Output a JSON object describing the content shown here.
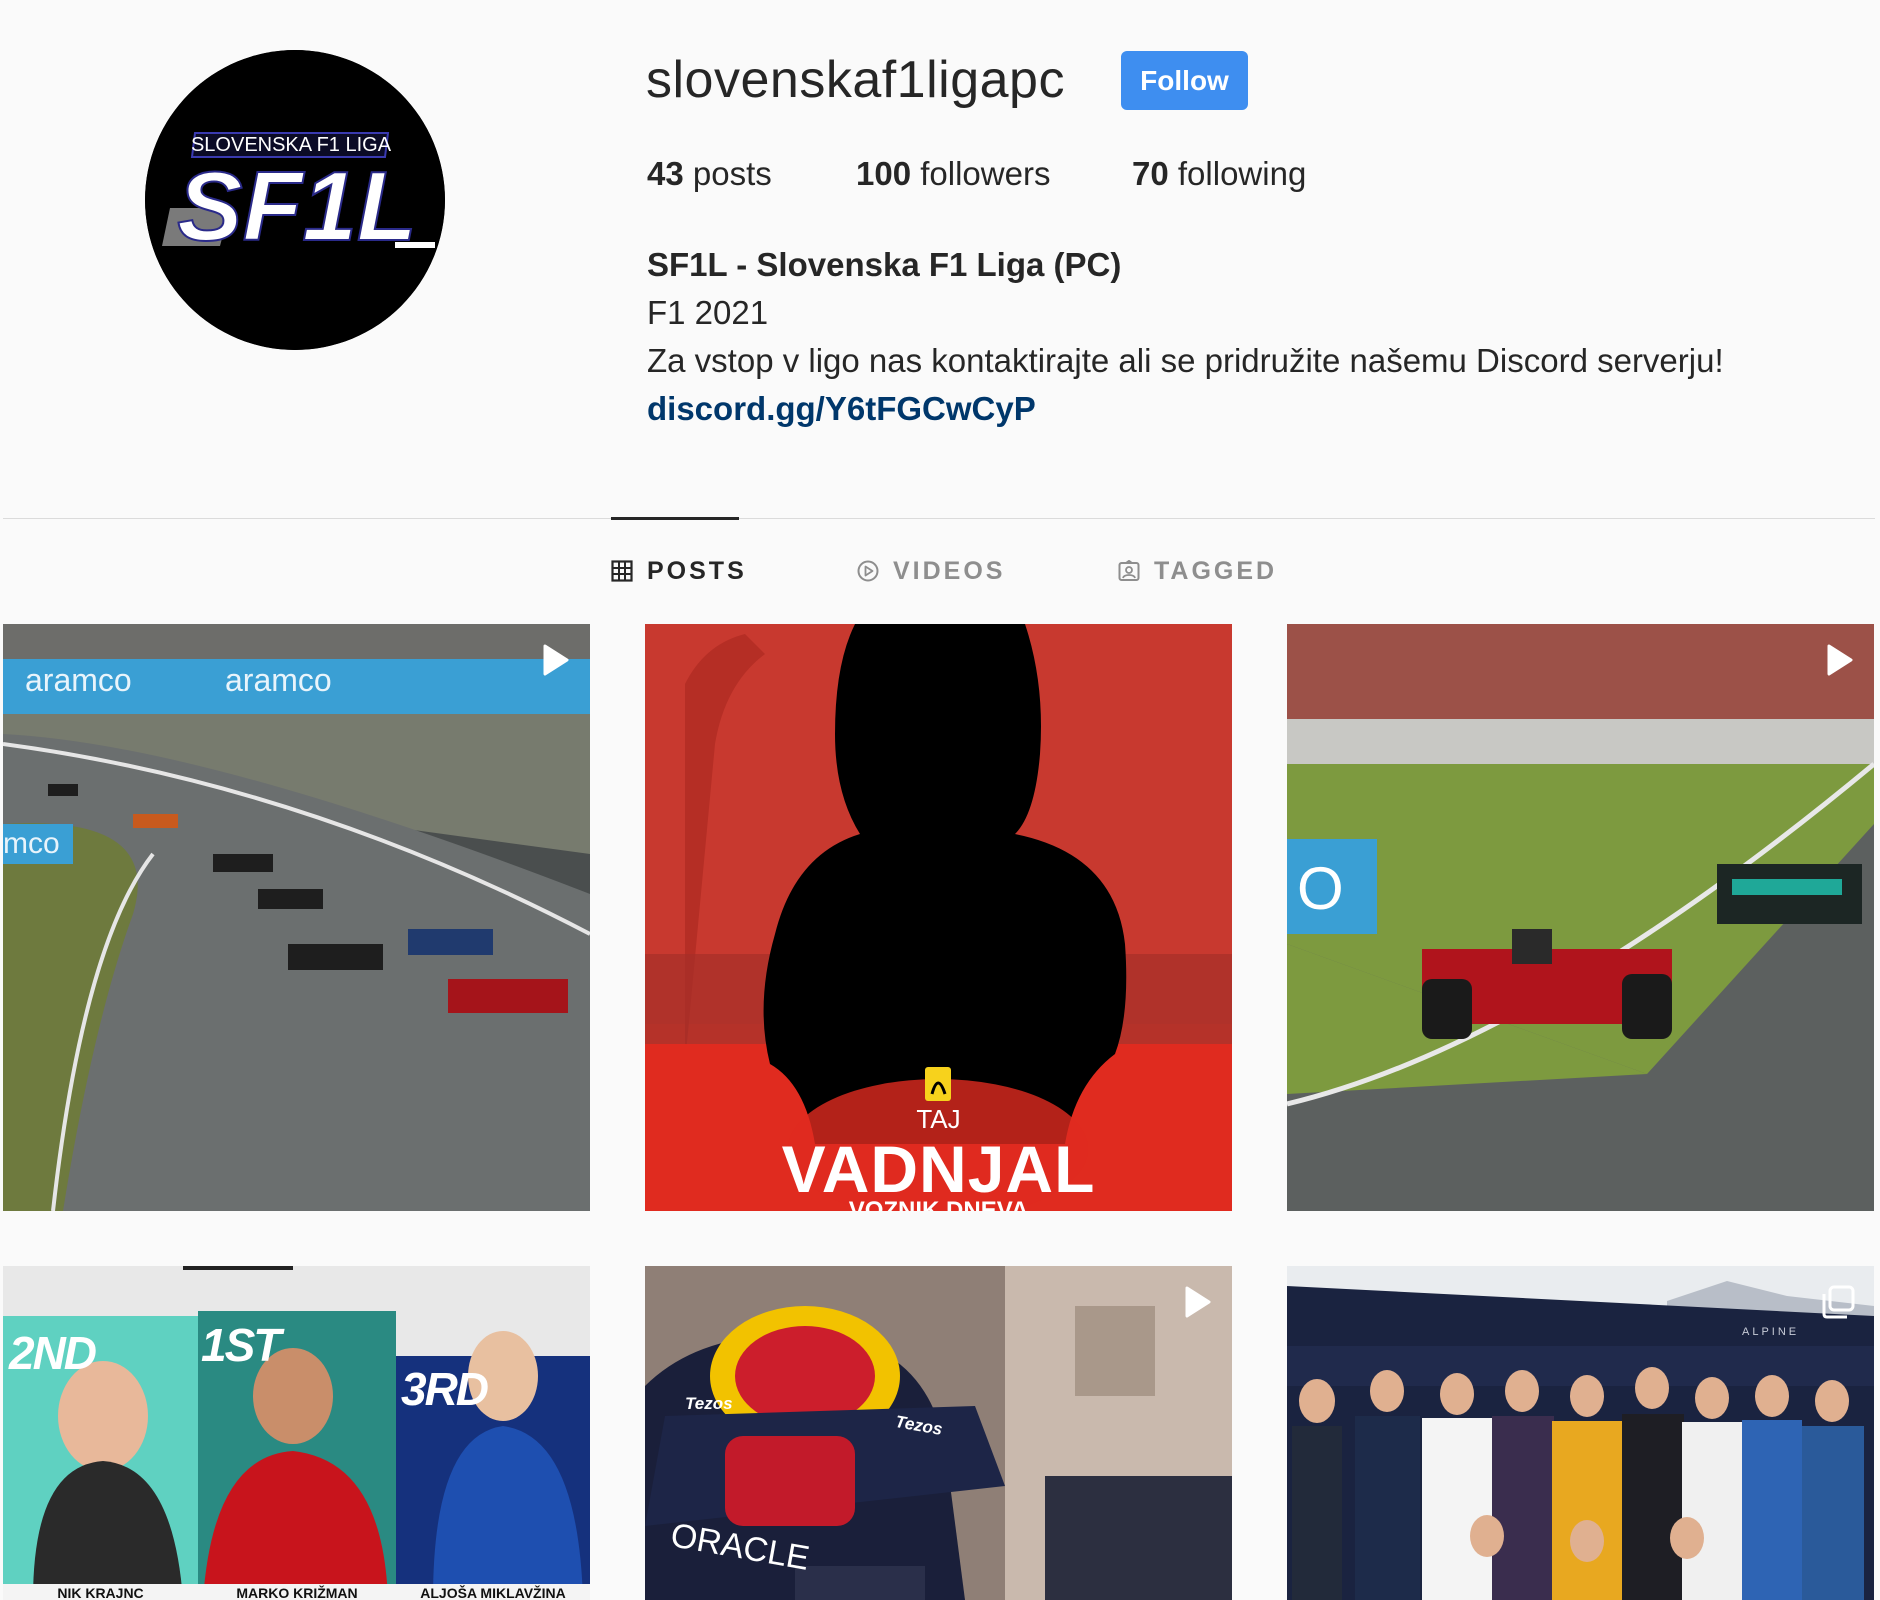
{
  "profile": {
    "username": "slovenskaf1ligapc",
    "follow_label": "Follow",
    "avatar_logo": {
      "top": "SLOVENSKA F1 LIGA",
      "main": "SF1L"
    },
    "stats": {
      "posts_count": "43",
      "posts_label": " posts",
      "followers_count": "100",
      "followers_label": " followers",
      "following_count": "70",
      "following_label": " following"
    },
    "bio": {
      "name": "SF1L - Slovenska F1 Liga (PC)",
      "line1": "F1 2021",
      "line2": "Za vstop v ligo nas kontaktirajte ali se pridružite našemu Discord serverju!",
      "link": "discord.gg/Y6tFGCwCyP"
    }
  },
  "tabs": [
    {
      "label": "POSTS",
      "icon": "grid-icon",
      "active": true
    },
    {
      "label": "VIDEOS",
      "icon": "play-circle-icon",
      "active": false
    },
    {
      "label": "TAGGED",
      "icon": "tagged-person-icon",
      "active": false
    }
  ],
  "posts": [
    {
      "type": "video",
      "banner": [
        "aramco",
        "aramco",
        "mco"
      ]
    },
    {
      "type": "image",
      "caption_small": "TAJ",
      "caption_big": "VADNJAL",
      "caption_sub": "VOZNIK DNEVA"
    },
    {
      "type": "video"
    },
    {
      "type": "image",
      "places": [
        "2ND",
        "1ST",
        "3RD"
      ],
      "names": [
        "NIK KRAJNC",
        "MARKO KRIŽMAN",
        "ALJOŠA MIKLAVŽINA"
      ]
    },
    {
      "type": "video",
      "sponsors": [
        "Tezos",
        "Tezos",
        "ORACLE"
      ]
    },
    {
      "type": "carousel",
      "text": "ALPINE"
    }
  ],
  "colors": {
    "accent": "#3e8ef0",
    "link": "#00376b",
    "ferrari_red": "#e02b1f"
  }
}
